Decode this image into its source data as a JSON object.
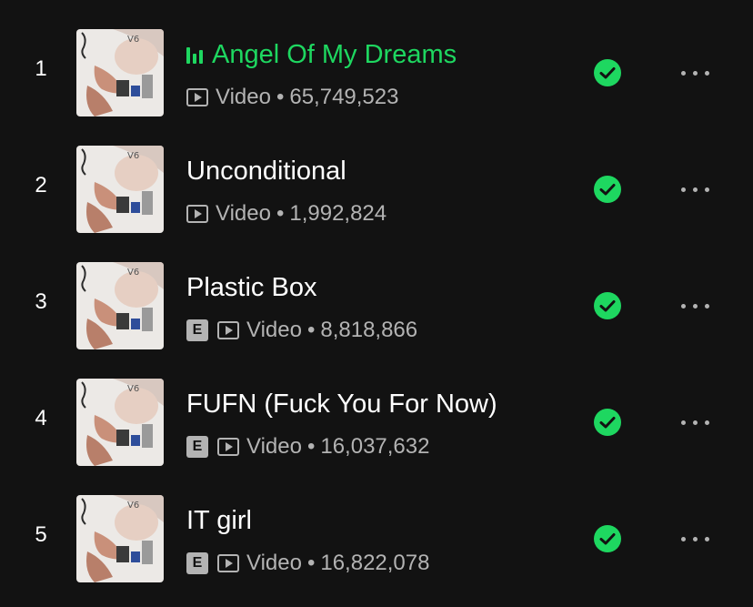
{
  "colors": {
    "background": "#121212",
    "accent": "#1ed760",
    "text_primary": "#ffffff",
    "text_secondary": "#b3b3b3"
  },
  "icons": {
    "now_playing": "equalizer-bars-icon",
    "video": "play-video-icon",
    "downloaded": "green-check-circle-icon",
    "more": "horizontal-ellipsis-icon",
    "explicit": "explicit-badge"
  },
  "tracks": [
    {
      "number": "1",
      "title": "Angel Of My Dreams",
      "playing": true,
      "explicit": false,
      "type_label": "Video",
      "separator": "•",
      "views": "65,749,523",
      "downloaded": true
    },
    {
      "number": "2",
      "title": "Unconditional",
      "playing": false,
      "explicit": false,
      "type_label": "Video",
      "separator": "•",
      "views": "1,992,824",
      "downloaded": true
    },
    {
      "number": "3",
      "title": "Plastic Box",
      "playing": false,
      "explicit": true,
      "explicit_label": "E",
      "type_label": "Video",
      "separator": "•",
      "views": "8,818,866",
      "downloaded": true
    },
    {
      "number": "4",
      "title": "FUFN (Fuck You For Now)",
      "playing": false,
      "explicit": true,
      "explicit_label": "E",
      "type_label": "Video",
      "separator": "•",
      "views": "16,037,632",
      "downloaded": true
    },
    {
      "number": "5",
      "title": "IT girl",
      "playing": false,
      "explicit": true,
      "explicit_label": "E",
      "type_label": "Video",
      "separator": "•",
      "views": "16,822,078",
      "downloaded": true
    }
  ]
}
